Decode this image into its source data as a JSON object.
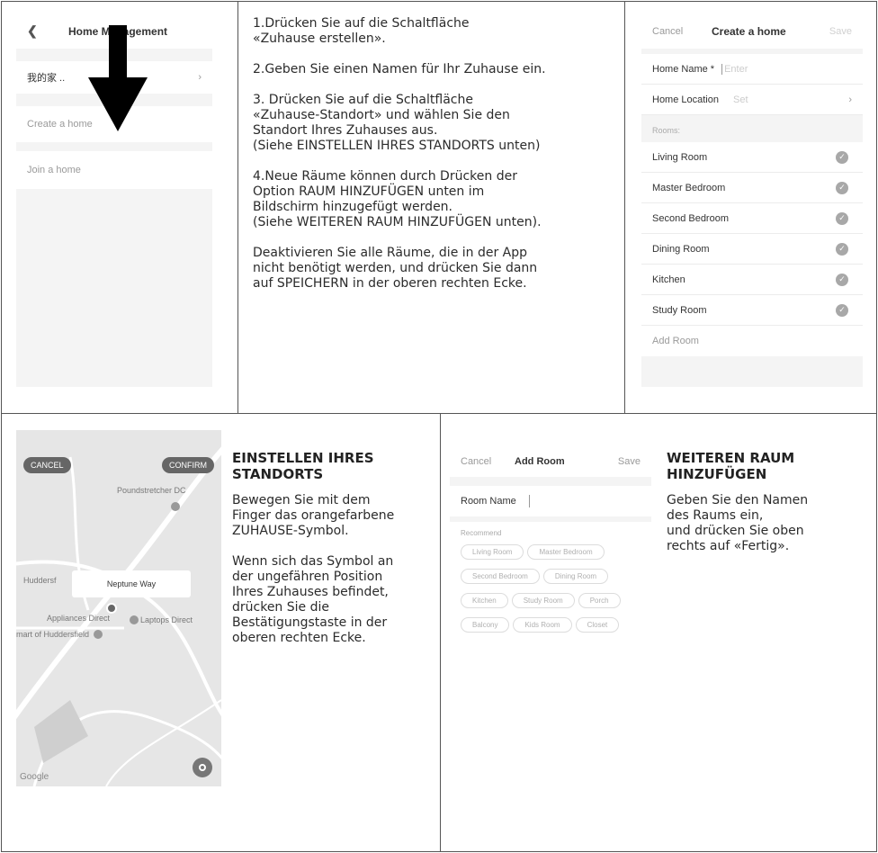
{
  "screen1": {
    "title": "Home Management",
    "family_item": "我的家 ..",
    "create_item": "Create a home",
    "join_item": "Join a home"
  },
  "steps": [
    "1.Drücken Sie auf die Schaltfläche\n«Zuhause erstellen».",
    "2.Geben Sie einen Namen für Ihr Zuhause ein.",
    "3. Drücken Sie auf die Schaltfläche\n«Zuhause-Standort» und wählen Sie den\nStandort Ihres Zuhauses aus.\n(Siehe EINSTELLEN IHRES STANDORTS unten)",
    "4.Neue Räume können durch Drücken der\nOption RAUM HINZUFÜGEN unten im\nBildschirm hinzugefügt werden.\n(Siehe WEITEREN RAUM HINZUFÜGEN unten).",
    "Deaktivieren Sie alle Räume, die in der App\nnicht benötigt werden, und drücken Sie dann\nauf SPEICHERN in der oberen rechten Ecke."
  ],
  "screen2": {
    "cancel": "Cancel",
    "title": "Create a home",
    "save": "Save",
    "home_name_label": "Home Name *",
    "home_name_placeholder": "Enter",
    "home_location_label": "Home Location",
    "home_location_value": "Set",
    "rooms_label": "Rooms:",
    "rooms": [
      "Living Room",
      "Master Bedroom",
      "Second Bedroom",
      "Dining Room",
      "Kitchen",
      "Study Room"
    ],
    "add_room": "Add Room"
  },
  "map": {
    "cancel": "CANCEL",
    "confirm": "CONFIRM",
    "place_label": "Neptune Way",
    "labels": [
      "Poundstretcher DC",
      "Huddersf",
      "Appliances Direct",
      "Laptops Direct",
      "mart of Huddersfield",
      "Google"
    ]
  },
  "location_section": {
    "heading": "EINSTELLEN IHRES\nSTANDORTS",
    "para1": "Bewegen Sie mit dem\nFinger das orangefarbene\nZUHAUSE-Symbol.",
    "para2": "Wenn sich das Symbol an\nder ungefähren Position\nIhres Zuhauses befindet,\ndrücken Sie die\nBestätigungstaste in der\noberen rechten Ecke."
  },
  "screen3": {
    "cancel": "Cancel",
    "title": "Add Room",
    "save": "Save",
    "room_name_label": "Room Name",
    "recommend_label": "Recommend",
    "chips": [
      [
        "Living Room",
        "Master Bedroom"
      ],
      [
        "Second Bedroom",
        "Dining Room"
      ],
      [
        "Kitchen",
        "Study Room",
        "Porch"
      ],
      [
        "Balcony",
        "Kids Room",
        "Closet"
      ]
    ]
  },
  "room_section": {
    "heading": "WEITEREN RAUM\nHINZUFÜGEN",
    "para": "Geben Sie den Namen\ndes Raums ein,\nund drücken Sie oben\nrechts auf «Fertig»."
  }
}
